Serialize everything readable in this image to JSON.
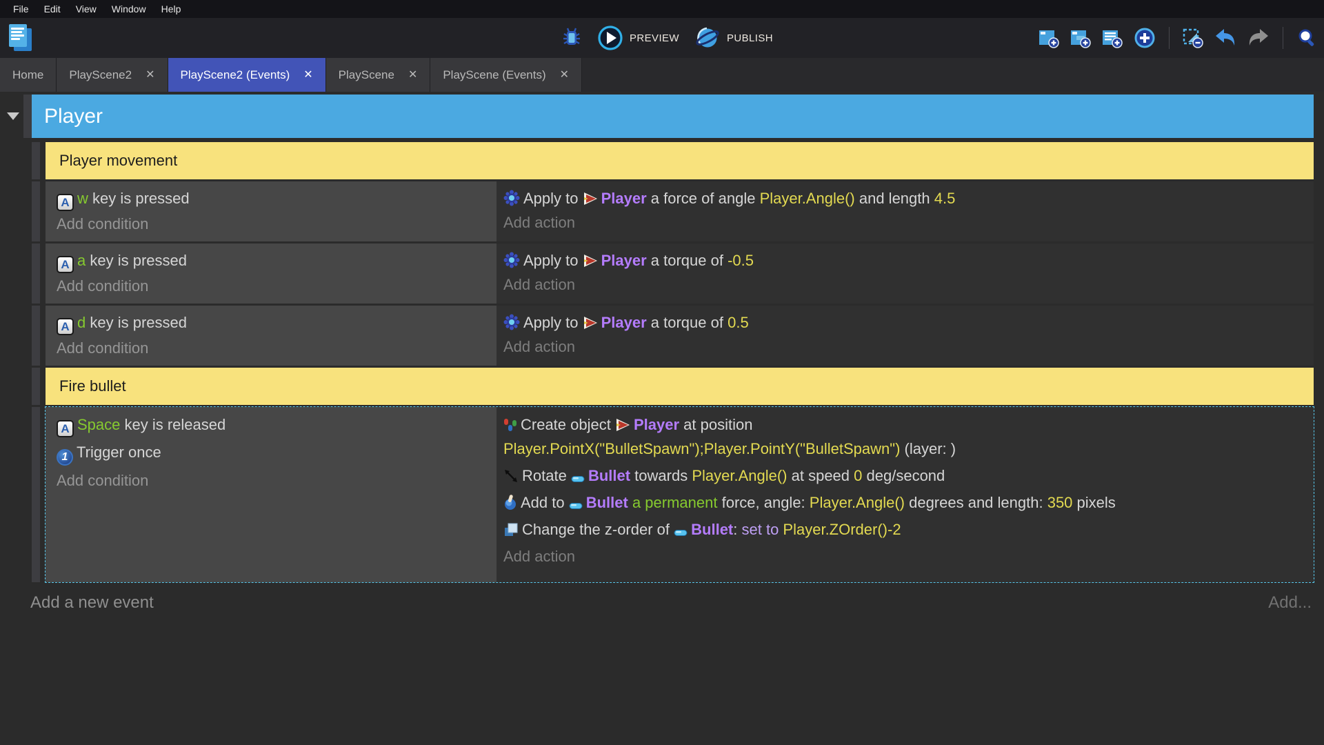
{
  "menu": {
    "items": [
      "File",
      "Edit",
      "View",
      "Window",
      "Help"
    ]
  },
  "toolbar": {
    "preview_label": "PREVIEW",
    "publish_label": "PUBLISH",
    "right_icons": [
      "add-event-icon",
      "add-subevent-icon",
      "add-comment-icon",
      "add-circle-icon",
      "separator",
      "delete-selection-icon",
      "undo-icon",
      "redo-icon",
      "separator",
      "search-icon"
    ]
  },
  "tabs": [
    {
      "label": "Home",
      "closable": false,
      "active": false
    },
    {
      "label": "PlayScene2",
      "closable": true,
      "active": false
    },
    {
      "label": "PlayScene2 (Events)",
      "closable": true,
      "active": true
    },
    {
      "label": "PlayScene",
      "closable": true,
      "active": false
    },
    {
      "label": "PlayScene (Events)",
      "closable": true,
      "active": false
    }
  ],
  "sheet": {
    "group_title": "Player",
    "add_condition": "Add condition",
    "add_action": "Add action",
    "add_new_event": "Add a new event",
    "add_more": "Add...",
    "sections": [
      {
        "header": "Player movement",
        "rows": [
          {
            "selected": false,
            "conditions": [
              [
                [
                  "i",
                  "keyboard-key-icon"
                ],
                [
                  "g",
                  "w"
                ],
                [
                  "t",
                  " key is pressed"
                ]
              ]
            ],
            "actions": [
              [
                [
                  "i",
                  "physics-icon"
                ],
                [
                  "t",
                  "Apply to "
                ],
                [
                  "i",
                  "player-object-icon"
                ],
                [
                  "o",
                  "Player"
                ],
                [
                  "t",
                  " a force of angle "
                ],
                [
                  "e",
                  "Player.Angle()"
                ],
                [
                  "t",
                  " and length "
                ],
                [
                  "e",
                  "4.5"
                ]
              ]
            ]
          },
          {
            "selected": false,
            "conditions": [
              [
                [
                  "i",
                  "keyboard-key-icon"
                ],
                [
                  "g",
                  "a"
                ],
                [
                  "t",
                  " key is pressed"
                ]
              ]
            ],
            "actions": [
              [
                [
                  "i",
                  "physics-icon"
                ],
                [
                  "t",
                  "Apply to "
                ],
                [
                  "i",
                  "player-object-icon"
                ],
                [
                  "o",
                  "Player"
                ],
                [
                  "t",
                  " a torque of "
                ],
                [
                  "e",
                  "-0.5"
                ]
              ]
            ]
          },
          {
            "selected": false,
            "conditions": [
              [
                [
                  "i",
                  "keyboard-key-icon"
                ],
                [
                  "g",
                  "d"
                ],
                [
                  "t",
                  " key is pressed"
                ]
              ]
            ],
            "actions": [
              [
                [
                  "i",
                  "physics-icon"
                ],
                [
                  "t",
                  "Apply to "
                ],
                [
                  "i",
                  "player-object-icon"
                ],
                [
                  "o",
                  "Player"
                ],
                [
                  "t",
                  " a torque of "
                ],
                [
                  "e",
                  "0.5"
                ]
              ]
            ]
          }
        ]
      },
      {
        "header": "Fire bullet",
        "rows": [
          {
            "selected": true,
            "conditions": [
              [
                [
                  "i",
                  "keyboard-key-icon"
                ],
                [
                  "g",
                  "Space"
                ],
                [
                  "t",
                  " key is released"
                ]
              ],
              [
                [
                  "i",
                  "trigger-once-icon"
                ],
                [
                  "t",
                  "Trigger once"
                ]
              ]
            ],
            "actions": [
              [
                [
                  "i",
                  "create-object-icon"
                ],
                [
                  "t",
                  "Create object "
                ],
                [
                  "i",
                  "player-object-icon"
                ],
                [
                  "o",
                  "Player"
                ],
                [
                  "t",
                  " at position "
                ],
                [
                  "b"
                ],
                [
                  "e",
                  "Player.PointX(\"BulletSpawn\");Player.PointY(\"BulletSpawn\")"
                ],
                [
                  "t",
                  " (layer: )"
                ]
              ],
              [
                [
                  "i",
                  "rotate-icon"
                ],
                [
                  "t",
                  "Rotate "
                ],
                [
                  "i",
                  "bullet-object-icon"
                ],
                [
                  "o",
                  "Bullet"
                ],
                [
                  "t",
                  " towards "
                ],
                [
                  "e",
                  "Player.Angle()"
                ],
                [
                  "t",
                  " at speed "
                ],
                [
                  "e",
                  "0"
                ],
                [
                  "t",
                  " deg/second"
                ]
              ],
              [
                [
                  "i",
                  "force-icon"
                ],
                [
                  "t",
                  "Add to "
                ],
                [
                  "i",
                  "bullet-object-icon"
                ],
                [
                  "o",
                  "Bullet"
                ],
                [
                  "g",
                  " a permanent"
                ],
                [
                  "t",
                  " force, angle: "
                ],
                [
                  "e",
                  "Player.Angle()"
                ],
                [
                  "t",
                  " degrees and length: "
                ],
                [
                  "e",
                  "350"
                ],
                [
                  "t",
                  " pixels"
                ]
              ],
              [
                [
                  "i",
                  "zorder-icon"
                ],
                [
                  "t",
                  "Change the z-order of "
                ],
                [
                  "i",
                  "bullet-object-icon"
                ],
                [
                  "o",
                  "Bullet"
                ],
                [
                  "t",
                  ": "
                ],
                [
                  "v",
                  "set to "
                ],
                [
                  "e",
                  "Player.ZOrder()-2"
                ]
              ]
            ]
          }
        ]
      }
    ]
  },
  "colors": {
    "accent_blue_group": "#4ba9e1",
    "accent_yellow_group": "#f8e27d",
    "active_tab": "#4254b7",
    "object_name": "#b47cfc",
    "expression": "#e3da51",
    "key_green": "#86ca2f",
    "selection_dashed": "#58c8ec"
  }
}
